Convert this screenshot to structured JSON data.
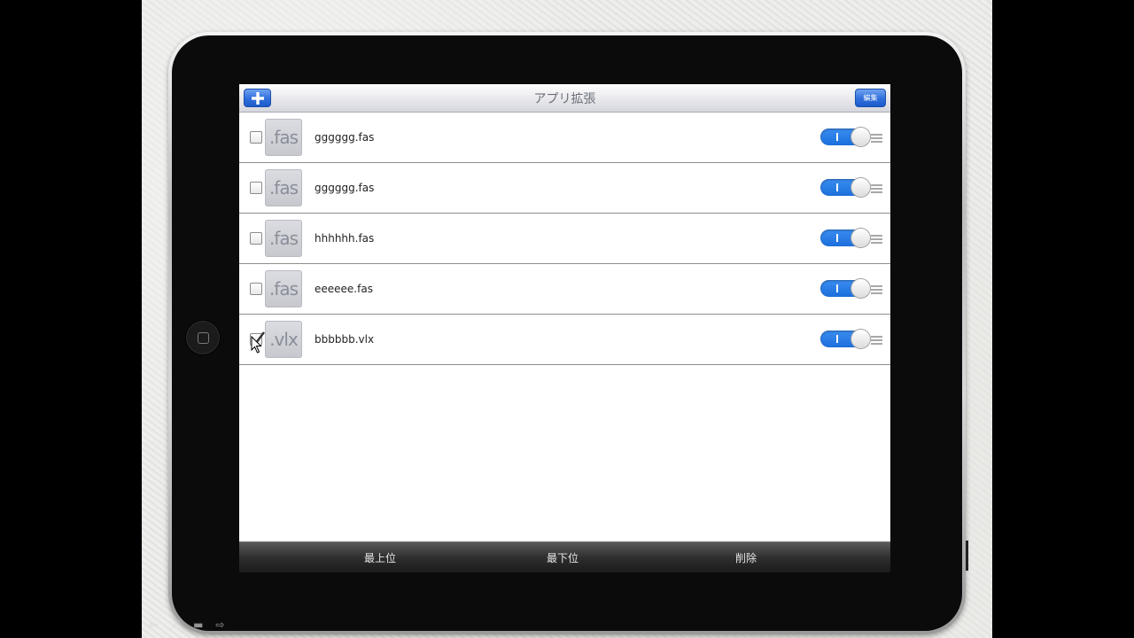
{
  "nav": {
    "title": "アプリ拡張",
    "edit_label": "編集"
  },
  "icons": {
    "add": "plus-icon",
    "check": "checkmark-icon",
    "drag": "reorder-handle-icon",
    "home": "home-button-icon"
  },
  "colors": {
    "accent": "#2f6edb",
    "toggle_on": "#1c6fdc",
    "toolbar": "#2e2e2e"
  },
  "files": [
    {
      "ext": ".fas",
      "name": "gggggg.fas",
      "checked": false,
      "enabled": true
    },
    {
      "ext": ".fas",
      "name": "gggggg.fas",
      "checked": false,
      "enabled": true
    },
    {
      "ext": ".fas",
      "name": "hhhhhh.fas",
      "checked": false,
      "enabled": true
    },
    {
      "ext": ".fas",
      "name": "eeeeee.fas",
      "checked": false,
      "enabled": true
    },
    {
      "ext": ".vlx",
      "name": "bbbbbb.vlx",
      "checked": true,
      "enabled": true
    }
  ],
  "toolbar": {
    "move_top_label": "最上位",
    "move_bottom_label": "最下位",
    "delete_label": "削除"
  }
}
